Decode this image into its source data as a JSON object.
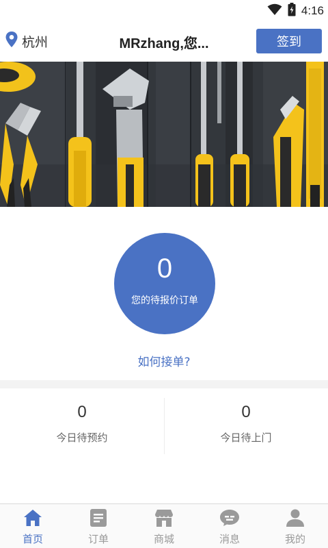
{
  "status_bar": {
    "time": "4:16",
    "wifi_icon": "wifi-icon",
    "battery_icon": "battery-icon"
  },
  "header": {
    "location_icon": "location-pin-icon",
    "city": "杭州",
    "greeting": "MRzhang,您...",
    "signin_label": "签到"
  },
  "banner": {
    "image_subject": "toolbox-tools-photo"
  },
  "pending": {
    "count": "0",
    "label": "您的待报价订单"
  },
  "howto_link": "如何接单?",
  "stats": [
    {
      "value": "0",
      "label": "今日待预约"
    },
    {
      "value": "0",
      "label": "今日待上门"
    }
  ],
  "bottom_nav": [
    {
      "label": "首页",
      "icon": "home-icon",
      "active": true
    },
    {
      "label": "订单",
      "icon": "order-list-icon",
      "active": false
    },
    {
      "label": "商城",
      "icon": "store-icon",
      "active": false
    },
    {
      "label": "消息",
      "icon": "message-icon",
      "active": false
    },
    {
      "label": "我的",
      "icon": "profile-icon",
      "active": false
    }
  ],
  "colors": {
    "accent": "#4a72c4",
    "inactive_nav": "#9a9a9a",
    "band": "#f3f3f3"
  }
}
